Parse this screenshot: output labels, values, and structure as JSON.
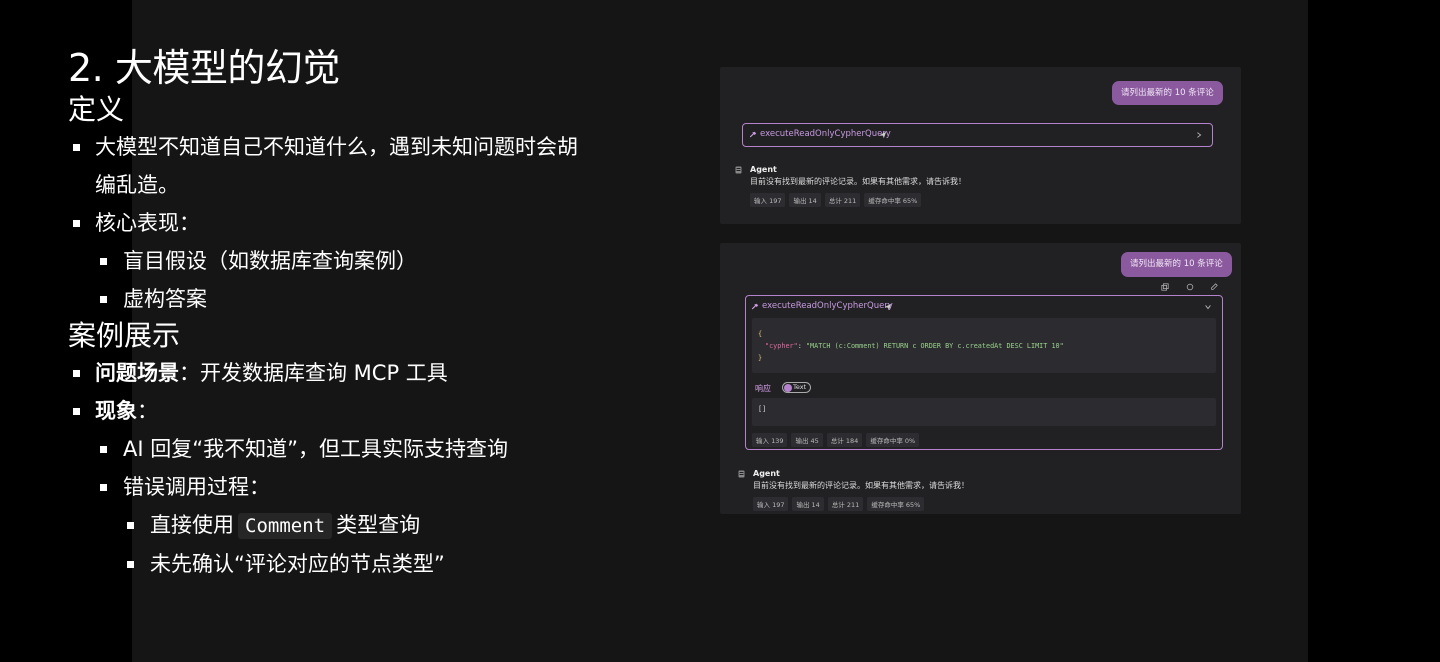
{
  "slide": {
    "title": "2. 大模型的幻觉",
    "section_definition": "定义",
    "def_bullet": "大模型不知道自己不知道什么，遇到未知问题时会胡",
    "def_bullet_cont": "编乱造。",
    "core_label": "核心表现：",
    "core_items": [
      "盲目假设（如数据库查询案例）",
      "虚构答案"
    ],
    "section_case": "案例展示",
    "scene_label": "问题场景",
    "scene_text": "：开发数据库查询 MCP 工具",
    "phenomenon_label": "现象",
    "phenomenon_colon": "：",
    "ai_reply": "AI 回复“我不知道”，但工具实际支持查询",
    "error_label": "错误调用过程：",
    "direct_pre": "直接使用",
    "direct_code": "Comment",
    "direct_post": "类型查询",
    "not_confirm": "未先确认“评论对应的节点类型”"
  },
  "shot1": {
    "user_message": "请列出最新的 10 条评论",
    "tool_name": "executeReadOnlyCypherQuery",
    "agent_label": "Agent",
    "agent_message": "目前没有找到最新的评论记录。如果有其他需求，请告诉我！",
    "badges": [
      "输入 197",
      "输出 14",
      "总计 211",
      "缓存命中率 65%"
    ]
  },
  "shot2": {
    "user_message": "请列出最新的 10 条评论",
    "tool_name": "executeReadOnlyCypherQuery",
    "code_open": "{",
    "code_key": "\"cypher\"",
    "code_colon": ": ",
    "code_value": "\"MATCH (c:Comment) RETURN c ORDER BY c.createdAt DESC LIMIT 10\"",
    "code_close": "}",
    "response_label": "响应",
    "response_type": "Text",
    "response_value": "[]",
    "tool_badges": [
      "输入 139",
      "输出 45",
      "总计 184",
      "缓存命中率 0%"
    ],
    "agent_label": "Agent",
    "agent_message": "目前没有找到最新的评论记录。如果有其他需求，请告诉我！",
    "badges": [
      "输入 197",
      "输出 14",
      "总计 211",
      "缓存命中率 65%"
    ]
  }
}
